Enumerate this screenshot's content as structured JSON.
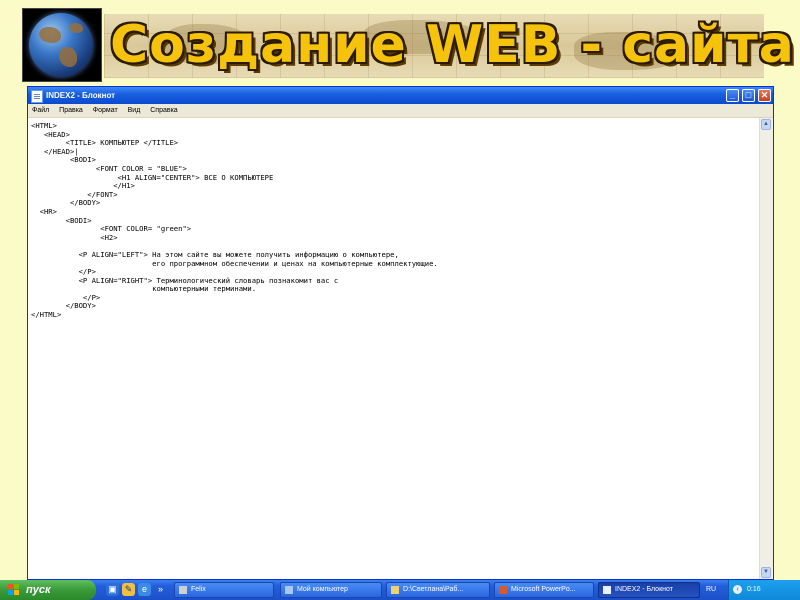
{
  "slide": {
    "title": "Создание WEB - сайта"
  },
  "notepad": {
    "window_title": "INDEX2 - Блокнот",
    "controls": {
      "minimize": "_",
      "maximize": "□",
      "close": "✕"
    },
    "menu": [
      "Файл",
      "Правка",
      "Формат",
      "Вид",
      "Справка"
    ],
    "code_lines": [
      "<HTML>",
      "   <HEAD>",
      "        <TITLE> КОМПЬЮТЕР </TITLE>",
      "   </HEAD>|",
      "         <BODI>",
      "               <FONT COLOR = \"BLUE\">",
      "                    <H1 ALIGN=\"CENTER\"> ВСЕ О КОМПЬЮТЕРЕ",
      "                   </H1>",
      "             </FONT>",
      "         </BODY>",
      "  <HR>",
      "        <BODI>",
      "                <FONT COLOR= \"green\">",
      "                <H2>",
      "",
      "           <P ALIGN=\"LEFT\"> На этом сайте вы можете получить информацию о компьютере,",
      "                            его программном обеспечении и ценах на компьютерные комплектующие.",
      "           </P>",
      "           <P ALIGN=\"RIGHT\"> Терминологический словарь познакомит вас с",
      "                            компьютерными терминами.",
      "            </P>",
      "        </BODY>",
      "</HTML>"
    ]
  },
  "taskbar": {
    "start_label": "пуск",
    "quick_launch_more": "»",
    "tasks": [
      {
        "label": "Felix",
        "icon": "felix-icon"
      },
      {
        "label": "Мой компьютер",
        "icon": "my-computer-icon"
      },
      {
        "label": "D:\\Светлана\\Раб...",
        "icon": "folder-icon"
      },
      {
        "label": "Microsoft PowerPo...",
        "icon": "powerpoint-icon"
      },
      {
        "label": "INDEX2 - Блокнот",
        "icon": "notepad-icon",
        "active": true
      }
    ],
    "language": "RU",
    "clock": "0:16"
  }
}
